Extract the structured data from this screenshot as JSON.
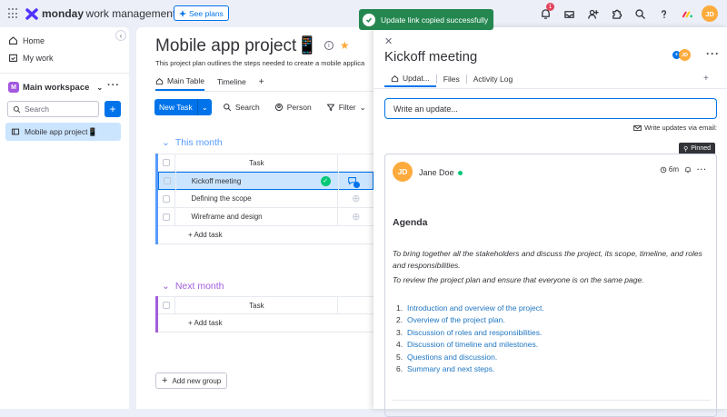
{
  "topbar": {
    "brand_bold": "monday",
    "brand_rest": "work management",
    "see_plans": "See plans",
    "notification_count": "1",
    "avatar": "JD"
  },
  "toast": {
    "text": "Update link copied successfully"
  },
  "sidebar": {
    "home": "Home",
    "my_work": "My work",
    "workspace_badge": "M",
    "workspace": "Main workspace",
    "search_placeholder": "Search",
    "board": "Mobile app project📱"
  },
  "board": {
    "title": "Mobile app project📱",
    "description": "This project plan outlines the steps needed to create a mobile applica",
    "tabs": [
      "Main Table",
      "Timeline"
    ],
    "toolbar": {
      "new_task": "New Task",
      "search": "Search",
      "person": "Person",
      "filter": "Filter"
    },
    "groups": [
      {
        "title": "This month",
        "color": "#579bfc",
        "header": "Task",
        "items": [
          "Kickoff meeting",
          "Defining the scope",
          "Wireframe and design"
        ],
        "add": "+ Add task"
      },
      {
        "title": "Next month",
        "color": "#a25ddc",
        "header": "Task",
        "items": [],
        "add": "+ Add task"
      }
    ],
    "add_group": "Add new group"
  },
  "panel": {
    "title": "Kickoff meeting",
    "tabs": [
      "Updat...",
      "Files",
      "Activity Log"
    ],
    "write_placeholder": "Write an update...",
    "via_email": "Write updates via email:",
    "pinned": "Pinned",
    "post": {
      "avatar": "JD",
      "author": "Jane Doe",
      "time": "6m",
      "heading": "Agenda",
      "para1": "To bring together all the stakeholders and discuss the project, its scope, timeline, and roles and responsibilities.",
      "para2": "To review the project plan and ensure that everyone is on the same page.",
      "list": [
        "Introduction and overview of the project.",
        "Overview of the project plan.",
        "Discussion of roles and responsibilities.",
        "Discussion of timeline and milestones.",
        "Questions and discussion.",
        "Summary and next steps."
      ],
      "list_numbers": [
        "1.",
        "2.",
        "3.",
        "4.",
        "5.",
        "6."
      ]
    }
  }
}
